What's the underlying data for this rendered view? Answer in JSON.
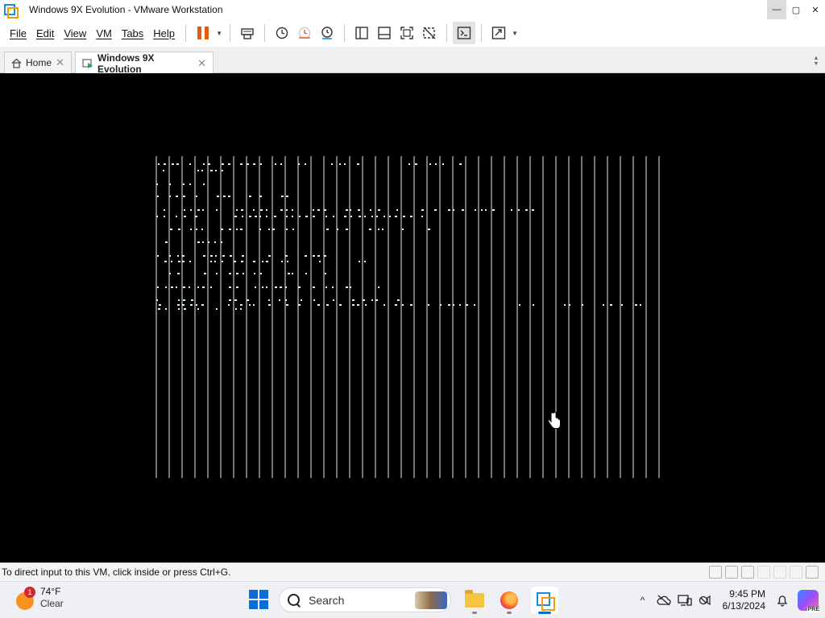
{
  "window": {
    "title": "Windows 9X Evolution - VMware Workstation",
    "minimize_glyph": "—",
    "maximize_glyph": "▢",
    "close_glyph": "✕"
  },
  "menu": {
    "items": [
      "File",
      "Edit",
      "View",
      "VM",
      "Tabs",
      "Help"
    ]
  },
  "toolbar": {
    "icons": [
      "pause-icon",
      "send-ctrl-alt-del-icon",
      "snapshot-icon",
      "revert-snapshot-icon",
      "snapshot-manager-icon",
      "library-icon",
      "thumbnail-bar-icon",
      "full-screen-icon",
      "unity-icon",
      "console-view-icon",
      "stretch-icon"
    ]
  },
  "tabs": [
    {
      "label": "Home",
      "icon": "home-icon",
      "close": "✕"
    },
    {
      "label": "Windows 9X Evolution",
      "icon": "vm-running-icon",
      "close": "✕"
    }
  ],
  "vm_screen": {
    "background": "#000000",
    "line_color": "#dff5df"
  },
  "statusbar": {
    "message": "To direct input to this VM, click inside or press Ctrl+G."
  },
  "taskbar": {
    "weather": {
      "badge": "1",
      "temperature": "74°F",
      "condition": "Clear"
    },
    "search": {
      "label": "Search"
    },
    "apps": [
      "file-explorer-icon",
      "firefox-icon",
      "vmware-icon"
    ],
    "tray": {
      "chevron": "^"
    },
    "clock": {
      "time": "9:45 PM",
      "date": "6/13/2024"
    }
  },
  "colors": {
    "accent": "#0a6cd6",
    "pause": "#e8590c",
    "vmware_blue": "#1f8bd6",
    "vmware_orange": "#f39c12"
  }
}
